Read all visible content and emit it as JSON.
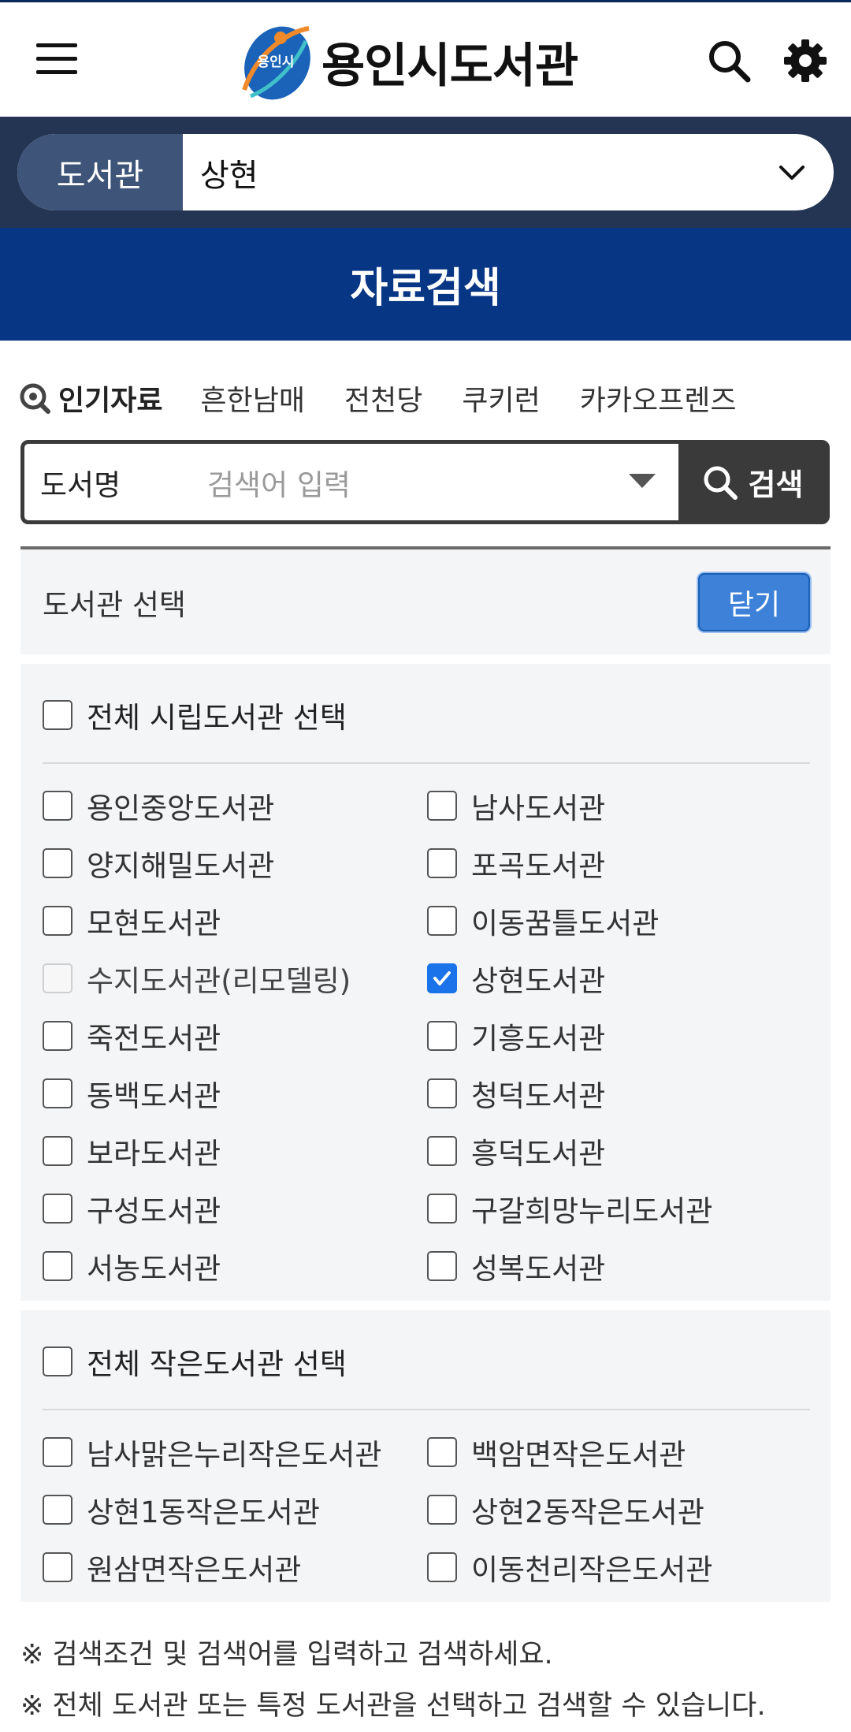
{
  "header": {
    "logo_emblem_text": "용인시",
    "logo_text": "용인시도서관",
    "search_icon": "search-icon",
    "settings_icon": "gear-icon"
  },
  "library_bar": {
    "label": "도서관",
    "selected": "상현"
  },
  "title": "자료검색",
  "popular": {
    "title": "인기자료",
    "keywords": [
      "흔한남매",
      "전천당",
      "쿠키런",
      "카카오프렌즈"
    ]
  },
  "search": {
    "field": "도서명",
    "placeholder": "검색어 입력",
    "button": "검색"
  },
  "library_select": {
    "title": "도서관 선택",
    "close": "닫기",
    "city_all": "전체 시립도서관 선택",
    "city": [
      {
        "label": "용인중앙도서관",
        "checked": false,
        "disabled": false
      },
      {
        "label": "남사도서관",
        "checked": false,
        "disabled": false
      },
      {
        "label": "양지해밀도서관",
        "checked": false,
        "disabled": false
      },
      {
        "label": "포곡도서관",
        "checked": false,
        "disabled": false
      },
      {
        "label": "모현도서관",
        "checked": false,
        "disabled": false
      },
      {
        "label": "이동꿈틀도서관",
        "checked": false,
        "disabled": false
      },
      {
        "label": "수지도서관(리모델링)",
        "checked": false,
        "disabled": true
      },
      {
        "label": "상현도서관",
        "checked": true,
        "disabled": false
      },
      {
        "label": "죽전도서관",
        "checked": false,
        "disabled": false
      },
      {
        "label": "기흥도서관",
        "checked": false,
        "disabled": false
      },
      {
        "label": "동백도서관",
        "checked": false,
        "disabled": false
      },
      {
        "label": "청덕도서관",
        "checked": false,
        "disabled": false
      },
      {
        "label": "보라도서관",
        "checked": false,
        "disabled": false
      },
      {
        "label": "흥덕도서관",
        "checked": false,
        "disabled": false
      },
      {
        "label": "구성도서관",
        "checked": false,
        "disabled": false
      },
      {
        "label": "구갈희망누리도서관",
        "checked": false,
        "disabled": false
      },
      {
        "label": "서농도서관",
        "checked": false,
        "disabled": false
      },
      {
        "label": "성복도서관",
        "checked": false,
        "disabled": false
      }
    ],
    "small_all": "전체 작은도서관 선택",
    "small": [
      {
        "label": "남사맑은누리작은도서관",
        "checked": false
      },
      {
        "label": "백암면작은도서관",
        "checked": false
      },
      {
        "label": "상현1동작은도서관",
        "checked": false
      },
      {
        "label": "상현2동작은도서관",
        "checked": false
      },
      {
        "label": "원삼면작은도서관",
        "checked": false
      },
      {
        "label": "이동천리작은도서관",
        "checked": false
      }
    ]
  },
  "notes": [
    "※ 검색조건 및 검색어를 입력하고 검색하세요.",
    "※ 전체 도서관 또는 특정 도서관을 선택하고 검색할 수 있습니다."
  ],
  "colors": {
    "title_band": "#073685",
    "library_bar": "#243554",
    "close_button": "#3d82d8",
    "checkbox_checked": "#1a73e8"
  }
}
